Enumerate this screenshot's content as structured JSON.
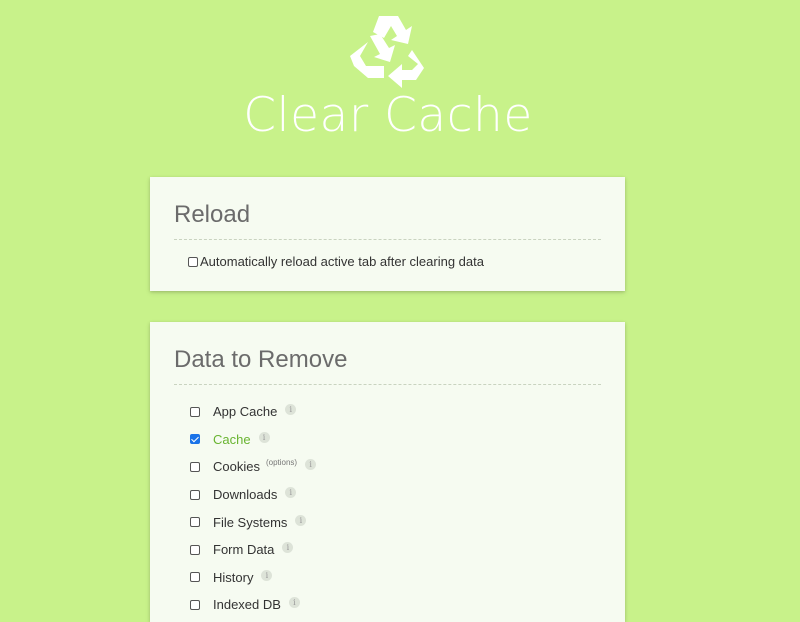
{
  "header": {
    "title": "Clear Cache"
  },
  "reload_card": {
    "title": "Reload",
    "option_label": "Automatically reload active tab after clearing data",
    "option_checked": false
  },
  "data_card": {
    "title": "Data to Remove",
    "items": [
      {
        "label": "App Cache",
        "checked": false
      },
      {
        "label": "Cache",
        "checked": true
      },
      {
        "label": "Cookies",
        "checked": false,
        "extra": "(options)"
      },
      {
        "label": "Downloads",
        "checked": false
      },
      {
        "label": "File Systems",
        "checked": false
      },
      {
        "label": "Form Data",
        "checked": false
      },
      {
        "label": "History",
        "checked": false
      },
      {
        "label": "Indexed DB",
        "checked": false
      }
    ],
    "info_glyph": "i"
  },
  "colors": {
    "background": "#c8f28a",
    "card": "#f6fbf1",
    "selected_label": "#69b431",
    "checkbox_checked": "#1a73e8"
  },
  "icons": {
    "logo": "recycle-icon",
    "info": "info-icon"
  }
}
